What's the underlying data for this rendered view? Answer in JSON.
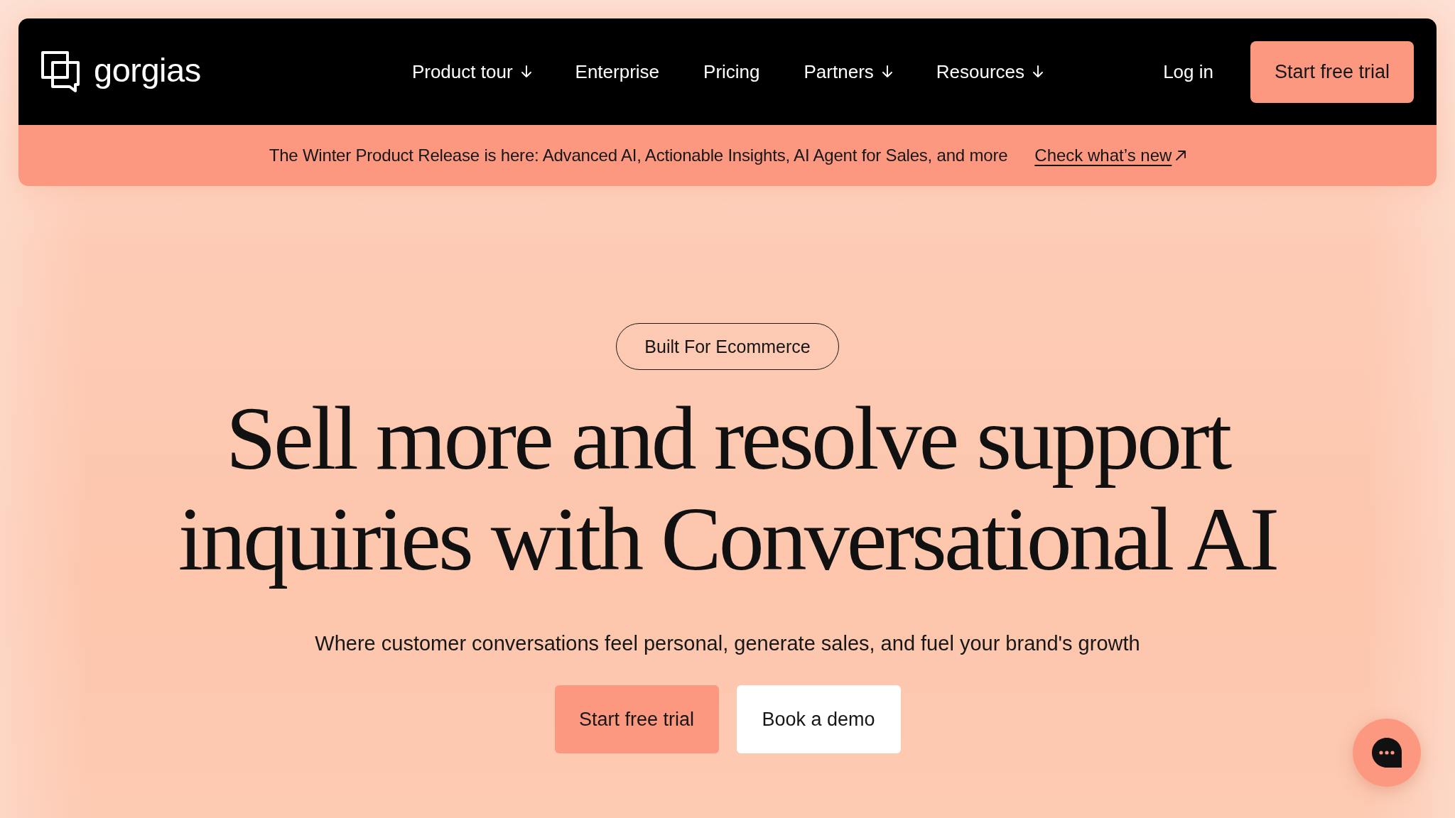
{
  "header": {
    "logo_text": "gorgias",
    "nav": [
      {
        "label": "Product tour",
        "has_menu": true
      },
      {
        "label": "Enterprise",
        "has_menu": false
      },
      {
        "label": "Pricing",
        "has_menu": false
      },
      {
        "label": "Partners",
        "has_menu": true
      },
      {
        "label": "Resources",
        "has_menu": true
      }
    ],
    "login": "Log in",
    "cta": "Start free trial"
  },
  "announcement": {
    "text": "The Winter Product Release is here: Advanced AI, Actionable Insights, AI Agent for Sales, and more",
    "link": "Check what’s new"
  },
  "hero": {
    "badge": "Built For Ecommerce",
    "headline_lines": [
      "Sell more and resolve support",
      "inquiries with Conversational AI"
    ],
    "subtitle": "Where customer conversations feel personal, generate sales, and fuel your brand's growth",
    "buttons": [
      {
        "label": "Start free trial",
        "kind": "primary"
      },
      {
        "label": "Book a demo",
        "kind": "secondary"
      }
    ]
  }
}
